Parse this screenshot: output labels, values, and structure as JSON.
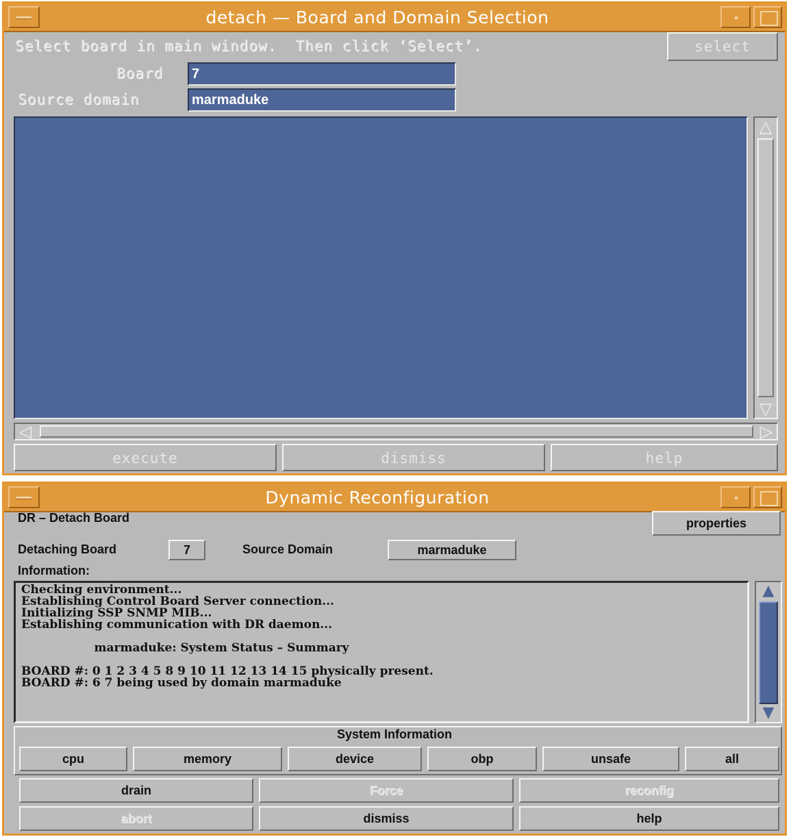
{
  "window1": {
    "title": "detach — Board and Domain Selection",
    "instruction": "Select board in main window.  Then click ‘Select’.",
    "select_button": "select",
    "board_label": "Board",
    "board_value": "7",
    "source_domain_label": "Source domain",
    "source_domain_value": "marmaduke",
    "buttons": {
      "execute": "execute",
      "dismiss": "dismiss",
      "help": "help"
    }
  },
  "window2": {
    "title": "Dynamic Reconfiguration",
    "heading": "DR – Detach Board",
    "properties_button": "properties",
    "detaching_board_label": "Detaching Board",
    "detaching_board_value": "7",
    "source_domain_label": "Source Domain",
    "source_domain_value": "marmaduke",
    "information_label": "Information:",
    "information_lines": [
      "Checking environment...",
      "Establishing Control Board Server connection...",
      "Initializing SSP SNMP MIB...",
      "Establishing communication with DR daemon...",
      "",
      "                  marmaduke: System Status – Summary",
      "",
      "BOARD #: 0 1 2 3 4 5 8 9 10 11 12 13 14 15 physically present.",
      "BOARD #: 6 7 being used by domain marmaduke"
    ],
    "system_information_label": "System Information",
    "system_buttons": {
      "cpu": "cpu",
      "memory": "memory",
      "device": "device",
      "obp": "obp",
      "unsafe": "unsafe",
      "all": "all"
    },
    "action_buttons": {
      "drain": "drain",
      "force": "Force",
      "reconfig": "reconfig",
      "abort": "abort",
      "dismiss": "dismiss",
      "help": "help"
    }
  },
  "colors": {
    "title_bar": "#e19a3b",
    "window_border": "#e5962f",
    "panel": "#b9b9b9",
    "field_blue": "#4e6597"
  }
}
